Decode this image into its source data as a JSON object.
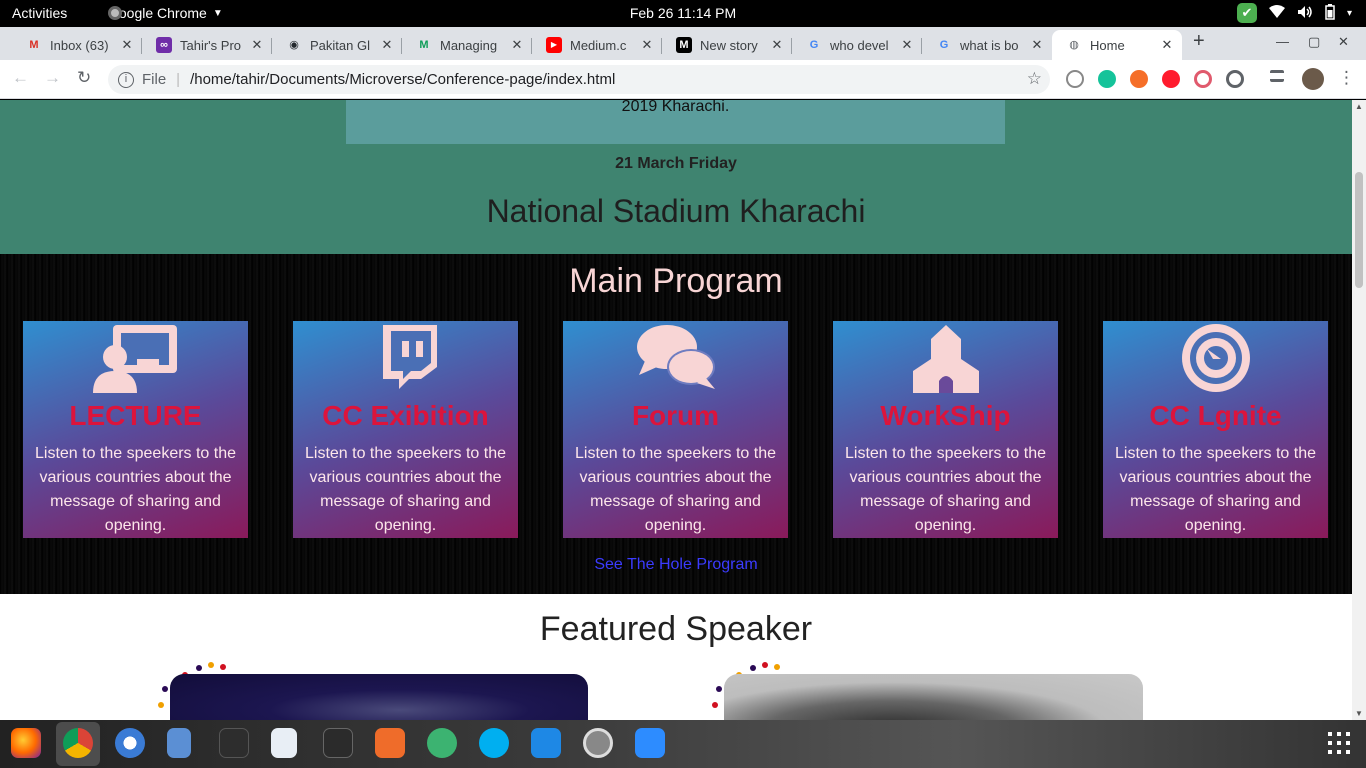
{
  "topbar": {
    "activities": "Activities",
    "app_name": "Google Chrome",
    "clock": "Feb 26  11:14 PM",
    "tray": {
      "shield": "✔",
      "wifi": "▲",
      "volume": "◀)",
      "battery": "▮",
      "caret": "▾"
    }
  },
  "browser": {
    "tabs": [
      {
        "title": "Inbox (63)",
        "icon": "gmail-icon",
        "color": "#d93025",
        "glyph": "M"
      },
      {
        "title": "Tahir's Pro",
        "icon": "microverse-icon",
        "color": "#6f2da8",
        "glyph": "∞"
      },
      {
        "title": "Pakitan Gl",
        "icon": "github-icon",
        "color": "#24292e",
        "glyph": "◉"
      },
      {
        "title": "Managing",
        "icon": "medium-m-icon",
        "color": "#0f9d58",
        "glyph": "M"
      },
      {
        "title": "Medium.c",
        "icon": "youtube-icon",
        "color": "#ff0000",
        "glyph": "▶"
      },
      {
        "title": "New story",
        "icon": "medium-icon",
        "color": "#000000",
        "glyph": "M"
      },
      {
        "title": "who devel",
        "icon": "google-icon",
        "color": "#4285f4",
        "glyph": "G"
      },
      {
        "title": "what is bo",
        "icon": "google-icon",
        "color": "#4285f4",
        "glyph": "G"
      },
      {
        "title": "Home",
        "icon": "globe-icon",
        "color": "#5f6368",
        "glyph": "◍"
      }
    ],
    "new_tab": "+",
    "window_controls": {
      "minimize": "—",
      "maximize": "▢",
      "close": "✕"
    },
    "nav": {
      "back": "←",
      "forward": "→",
      "reload": "↻"
    },
    "address": {
      "info": "i",
      "scheme": "File",
      "url": "/home/tahir/Documents/Microverse/Conference-page/index.html",
      "star": "☆"
    },
    "toolbar_menu": "⋮"
  },
  "page": {
    "event_text": "2019 Kharachi.",
    "event_date": "21 March Friday",
    "event_place": "National Stadium Kharachi",
    "program_title": "Main Program",
    "cards": [
      {
        "title": "LECTURE",
        "text": "Listen to the speekers to the various countries about the message of sharing and opening.",
        "icon": "presentation-icon"
      },
      {
        "title": "CC Exibition",
        "text": "Listen to the speekers to the various countries about the message of sharing and opening.",
        "icon": "twitch-icon"
      },
      {
        "title": "Forum",
        "text": "Listen to the speekers to the various countries about the message of sharing and opening.",
        "icon": "chat-icon"
      },
      {
        "title": "WorkShip",
        "text": "Listen to the speekers to the various countries about the message of sharing and opening.",
        "icon": "church-icon"
      },
      {
        "title": "CC Lgnite",
        "text": "Listen to the speekers to the various countries about the message of sharing and opening.",
        "icon": "target-icon"
      }
    ],
    "see_program": "See The Hole Program",
    "featured_title": "Featured Speaker"
  },
  "dock": {
    "apps": [
      "firefox-icon",
      "chrome-icon",
      "thunderbird-icon",
      "files-icon",
      "terminal-icon",
      "text-editor-icon",
      "system-monitor-icon",
      "software-icon",
      "atom-icon",
      "skype-icon",
      "vscode-icon",
      "app-icon",
      "zoom-icon"
    ],
    "apps_grid": "⋮⋮⋮"
  },
  "colors": {
    "event_bg": "#3f8470",
    "card_title": "#dc143c",
    "icon_pink": "#f8d5d5",
    "link": "#3b3bff"
  }
}
